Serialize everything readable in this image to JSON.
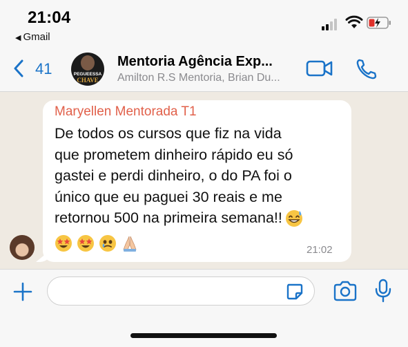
{
  "status_bar": {
    "time": "21:04",
    "back_app_label": "Gmail",
    "battery_color": "#e0312b",
    "signal_bars_active": 2,
    "signal_bars_total": 4
  },
  "header": {
    "back_count": "41",
    "group_title": "Mentoria Agência Exp...",
    "group_members": "Amilton R.S Mentoria, Brian Du...",
    "avatar_text_top": "PEGUEESSA",
    "avatar_text_bottom": "CHAVE",
    "accent_color": "#1a73c8"
  },
  "message": {
    "sender_name": "Maryellen Mentorada T1",
    "sender_color": "#e1604a",
    "lines": [
      "De todos os cursos que fiz na vida",
      "que prometem dinheiro rápido eu só",
      "gastei e perdi dinheiro, o do PA foi o",
      "único que eu paguei 30 reais e me",
      "retornou 500 na primeira semana!!"
    ],
    "time": "21:02",
    "emoji_names": [
      "sweat-smile-emoji",
      "star-struck-emoji",
      "star-struck-emoji",
      "face-holding-back-tears-emoji",
      "folded-hands-emoji"
    ]
  },
  "composer": {
    "input_value": ""
  }
}
